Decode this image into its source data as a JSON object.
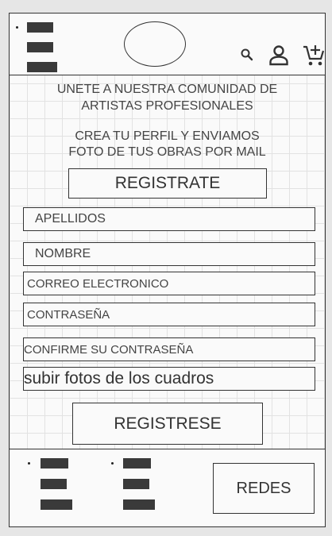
{
  "header": {
    "menu_icon": "hamburger-menu-icon",
    "logo_placeholder": "logo-oval",
    "icons": [
      "search-icon",
      "user-icon",
      "add-to-cart-icon"
    ]
  },
  "intro": {
    "line1": "UNETE A NUESTRA COMUNIDAD DE",
    "line2": "ARTISTAS PROFESIONALES",
    "line3": "CREA TU PERFIL Y ENVIAMOS",
    "line4": "FOTO DE TUS OBRAS POR MAIL"
  },
  "form": {
    "title": "REGISTRATE",
    "fields": {
      "apellidos": "APELLIDOS",
      "nombre": "NOMBRE",
      "correo": "CORREO ELECTRONICO",
      "contrasena": "CONTRASEÑA",
      "confirme": "CONFIRME SU CONTRASEÑA",
      "fotos": "subir fotos de los cuadros"
    },
    "submit_label": "REGISTRESE"
  },
  "footer": {
    "redes_label": "REDES"
  }
}
